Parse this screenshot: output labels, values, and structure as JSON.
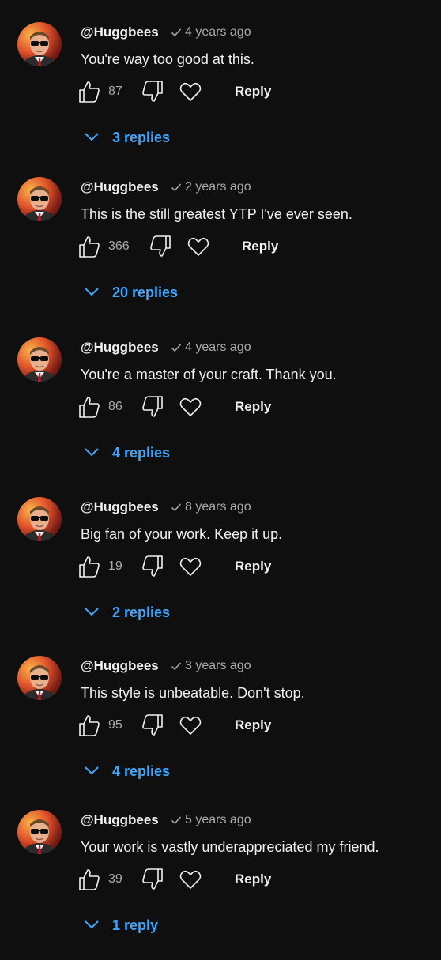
{
  "colors": {
    "background": "#0f0f0f",
    "text": "#f1f1f1",
    "muted": "#aaaaaa",
    "link": "#3ea6ff"
  },
  "icons": {
    "verified": "checkmark-icon",
    "like": "thumbs-up-icon",
    "dislike": "thumbs-down-icon",
    "heart": "heart-icon",
    "expand": "chevron-down-icon"
  },
  "comments": [
    {
      "author": "@Huggbees",
      "time": "4 years ago",
      "text": "You're way too good at this.",
      "likes": "87",
      "reply_label": "Reply",
      "replies_label": "3 replies"
    },
    {
      "author": "@Huggbees",
      "time": "2 years ago",
      "text": "This is the still greatest YTP I've ever seen.",
      "likes": "366",
      "reply_label": "Reply",
      "replies_label": "20 replies"
    },
    {
      "author": "@Huggbees",
      "time": "4 years ago",
      "text": "You're a master of your craft. Thank you.",
      "likes": "86",
      "reply_label": "Reply",
      "replies_label": "4 replies"
    },
    {
      "author": "@Huggbees",
      "time": "8 years ago",
      "text": "Big fan of your work. Keep it up.",
      "likes": "19",
      "reply_label": "Reply",
      "replies_label": "2 replies"
    },
    {
      "author": "@Huggbees",
      "time": "3 years ago",
      "text": "This style is unbeatable. Don't stop.",
      "likes": "95",
      "reply_label": "Reply",
      "replies_label": "4 replies"
    },
    {
      "author": "@Huggbees",
      "time": "5 years ago",
      "text": "Your work is vastly underappreciated my friend.",
      "likes": "39",
      "reply_label": "Reply",
      "replies_label": "1 reply"
    }
  ]
}
